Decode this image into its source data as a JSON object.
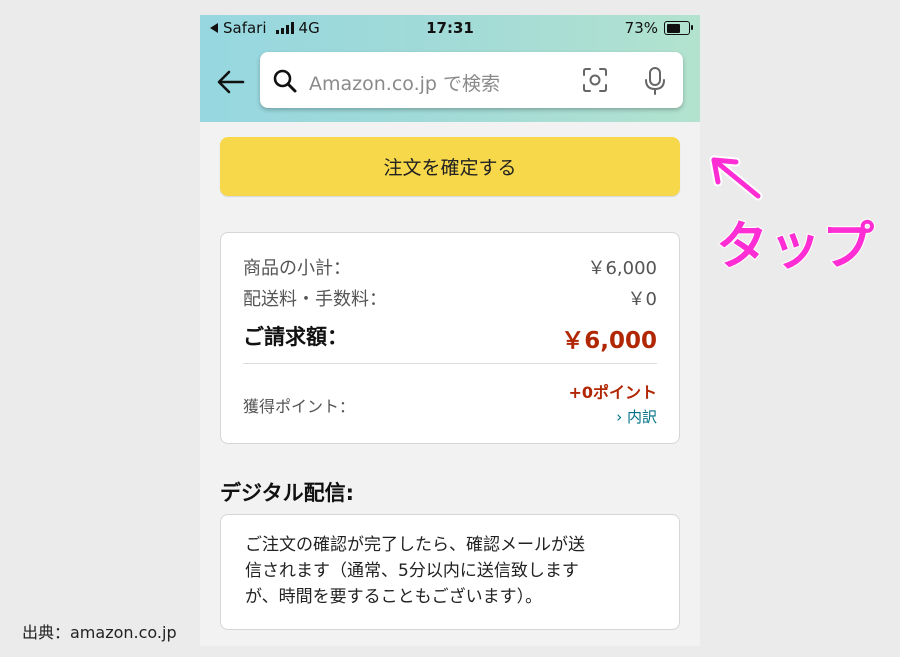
{
  "status_bar": {
    "carrier": "Safari",
    "network": "4G",
    "time": "17:31",
    "battery": "73%",
    "battery_level": 0.73
  },
  "search": {
    "placeholder": "Amazon.co.jp で検索",
    "icons": [
      "back-arrow-icon",
      "search-icon",
      "camera-scan-icon",
      "microphone-icon"
    ]
  },
  "place_order_button": "注文を確定する",
  "summary": {
    "subtotal_label": "商品の小計：",
    "subtotal_value": "￥6,000",
    "shipping_label": "配送料・手数料：",
    "shipping_value": "￥0",
    "total_label": "ご請求額：",
    "total_value": "￥6,000",
    "points_label": "獲得ポイント：",
    "points_value": "+0ポイント",
    "breakdown_link": "› 内訳"
  },
  "digital_delivery": {
    "title": "デジタル配信:",
    "lines": [
      "ご注文の確認が完了したら、確認メールが送",
      "信されます（通常、5分以内に送信致します",
      "が、時間を要することもございます）。"
    ]
  },
  "annotation": {
    "label": "タップ",
    "color": "#ff2dd4"
  },
  "source": "出典：amazon.co.jp",
  "colors": {
    "cta_yellow": "#f7d84a",
    "price_red": "#b12704",
    "link_teal": "#007185"
  }
}
